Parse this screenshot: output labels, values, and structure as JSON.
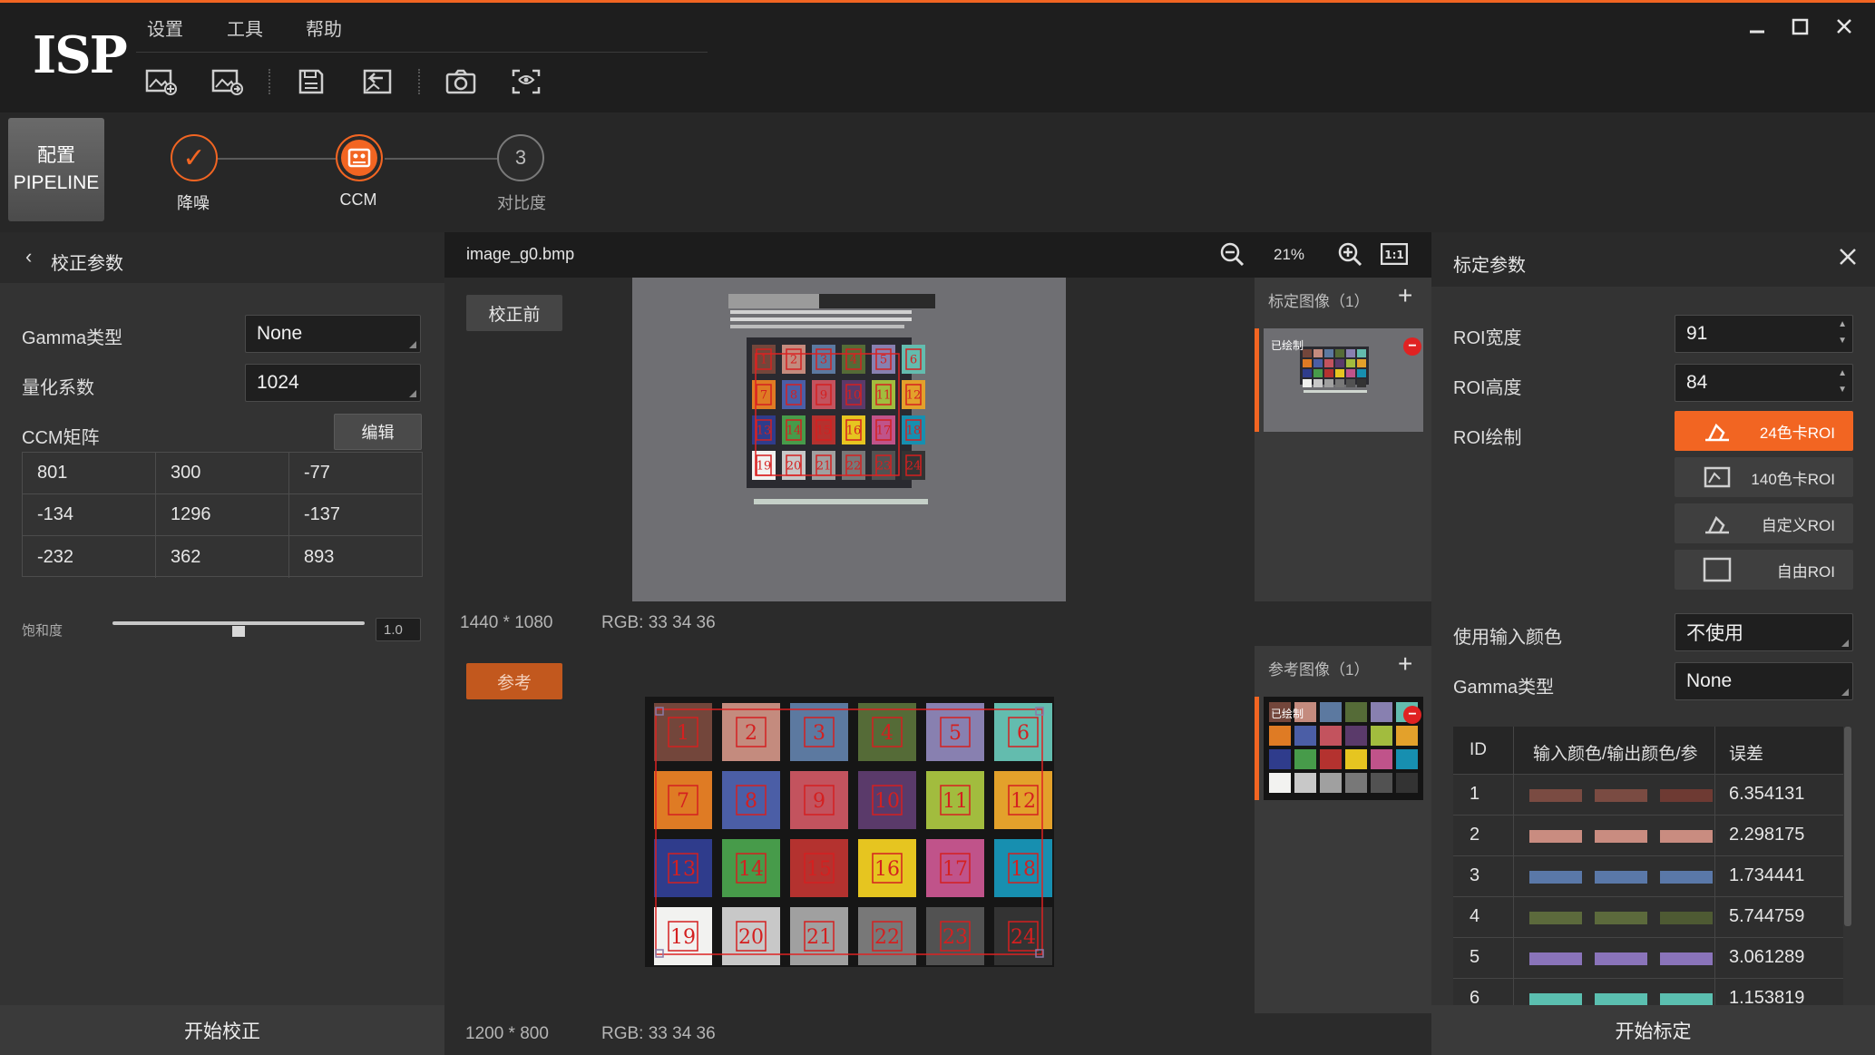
{
  "app": {
    "logo": "ISP",
    "menu": [
      "设置",
      "工具",
      "帮助"
    ]
  },
  "pipeline": {
    "button_line1": "配置",
    "button_line2": "PIPELINE",
    "steps": [
      {
        "label": "降噪",
        "state": "done",
        "symbol": "✓"
      },
      {
        "label": "CCM",
        "state": "active",
        "symbol": ""
      },
      {
        "label": "对比度",
        "state": "pending",
        "symbol": "3"
      }
    ]
  },
  "left": {
    "back_title": "校正参数",
    "gamma_label": "Gamma类型",
    "gamma_value": "None",
    "quant_label": "量化系数",
    "quant_value": "1024",
    "ccm_label": "CCM矩阵",
    "edit_label": "编辑",
    "ccm": [
      [
        "801",
        "300",
        "-77"
      ],
      [
        "-134",
        "1296",
        "-137"
      ],
      [
        "-232",
        "362",
        "893"
      ]
    ],
    "saturation_label": "饱和度",
    "saturation_value": "1.0",
    "saturation_fraction": 0.5,
    "start_label": "开始校正"
  },
  "center": {
    "filename": "image_g0.bmp",
    "zoom": "21%",
    "before_label": "校正前",
    "top_size": "1440 * 1080",
    "top_rgb": "RGB: 33 34 36",
    "ref_label": "参考",
    "bot_size": "1200 * 800",
    "bot_rgb": "RGB: 33 34 36",
    "calib_images": "标定图像（1）",
    "ref_images": "参考图像（1）",
    "drawn_tag": "已绘制"
  },
  "right": {
    "title": "标定参数",
    "roi_w_label": "ROI宽度",
    "roi_w_value": "91",
    "roi_h_label": "ROI高度",
    "roi_h_value": "84",
    "roi_draw_label": "ROI绘制",
    "roi_buttons": [
      "24色卡ROI",
      "140色卡ROI",
      "自定义ROI",
      "自由ROI"
    ],
    "use_input_label": "使用输入颜色",
    "use_input_value": "不使用",
    "gamma_label": "Gamma类型",
    "gamma_value": "None",
    "table_headers": [
      "ID",
      "输入颜色/输出颜色/参",
      "误差"
    ],
    "rows": [
      {
        "id": "1",
        "colors": [
          "#7a4b42",
          "#7a4b42",
          "#6e3a33"
        ],
        "error": "6.354131"
      },
      {
        "id": "2",
        "colors": [
          "#c98c80",
          "#c98c80",
          "#c98c80"
        ],
        "error": "2.298175"
      },
      {
        "id": "3",
        "colors": [
          "#5a78a8",
          "#5a78a8",
          "#5a78a8"
        ],
        "error": "1.734441"
      },
      {
        "id": "4",
        "colors": [
          "#5c6a3c",
          "#5c6a3c",
          "#4e5a33"
        ],
        "error": "5.744759"
      },
      {
        "id": "5",
        "colors": [
          "#8a74ba",
          "#8a74ba",
          "#8a74ba"
        ],
        "error": "3.061289"
      },
      {
        "id": "6",
        "colors": [
          "#5bbfb0",
          "#5bbfb0",
          "#5bbfb0"
        ],
        "error": "1.153819"
      }
    ],
    "start_label": "开始标定"
  },
  "chart_colors": {
    "accent": "#f26522",
    "patches": [
      "#73463b",
      "#c48b7e",
      "#5c79a0",
      "#556b37",
      "#8880b0",
      "#63bcae",
      "#df7b24",
      "#4b5ea6",
      "#c3535e",
      "#5a3a6a",
      "#a2bc3e",
      "#e3a12b",
      "#2f3c8c",
      "#479b4a",
      "#b4322f",
      "#e6c520",
      "#c0538a",
      "#178fb0",
      "#f2f2f0",
      "#c8c8c8",
      "#a0a0a0",
      "#787878",
      "#525252",
      "#333333"
    ],
    "patch_numbers": [
      "1",
      "2",
      "3",
      "4",
      "5",
      "6",
      "7",
      "8",
      "9",
      "10",
      "11",
      "12",
      "13",
      "14",
      "15",
      "16",
      "17",
      "18",
      "19",
      "20",
      "21",
      "22",
      "23",
      "24"
    ]
  }
}
